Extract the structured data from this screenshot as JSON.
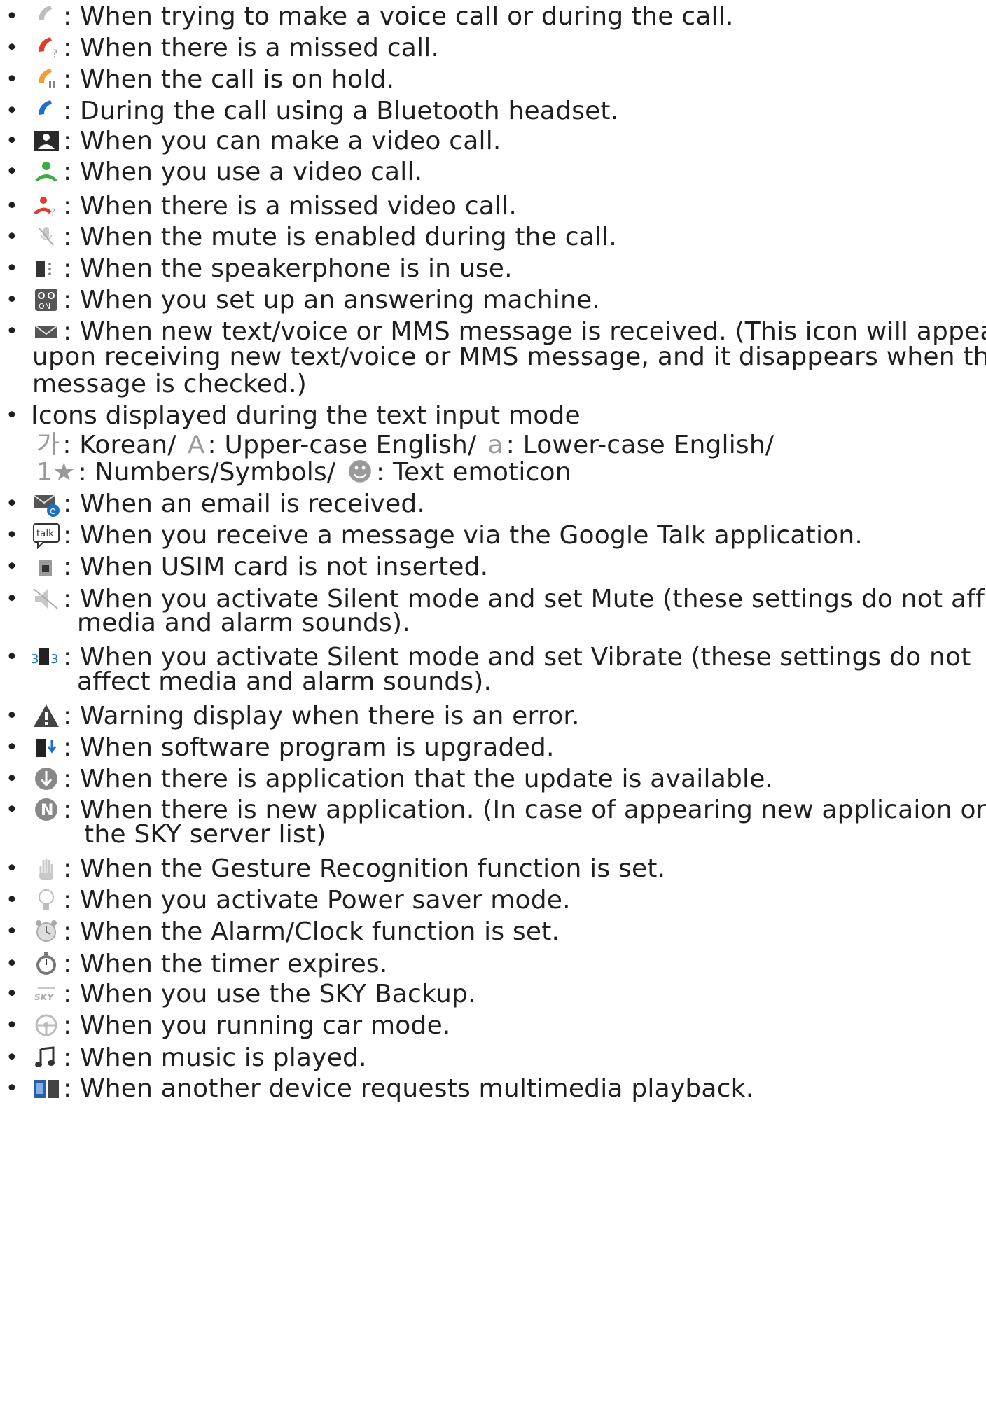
{
  "items": [
    {
      "icon": "phone-gray-icon",
      "text": ": When trying to make a voice call or during the call."
    },
    {
      "icon": "phone-missed-icon",
      "text": ": When there is a missed call."
    },
    {
      "icon": "phone-hold-icon",
      "text": ": When the call is on hold."
    },
    {
      "icon": "phone-bluetooth-icon",
      "text": ": During the call using a Bluetooth headset."
    },
    {
      "icon": "video-call-available-icon",
      "text": ": When you can make a video call."
    },
    {
      "icon": "video-call-active-icon",
      "text": ": When you use a video call."
    },
    {
      "icon": "video-call-missed-icon",
      "text": ": When there is a missed video call."
    },
    {
      "icon": "mic-mute-icon",
      "text": ": When the mute is enabled during the call."
    },
    {
      "icon": "speakerphone-icon",
      "text": ": When the speakerphone is in use."
    },
    {
      "icon": "answering-machine-icon",
      "text": ": When you set up an answering machine."
    },
    {
      "icon": "message-envelope-icon",
      "text": ": When new text/voice or MMS message is received. (This icon will appear",
      "cont": [
        "upon receiving new text/voice or MMS message, and it disappears when the",
        "message is checked.)"
      ]
    },
    {
      "icon": "",
      "text": "Icons displayed during the text input mode"
    },
    {
      "icon": "email-received-icon",
      "text": ": When an email is received."
    },
    {
      "icon": "google-talk-icon",
      "text": ": When you receive a message via the Google Talk application."
    },
    {
      "icon": "usim-missing-icon",
      "text": ": When USIM card is not inserted."
    },
    {
      "icon": "silent-mute-icon",
      "text": ": When you activate Silent mode and set Mute (these settings do not affect",
      "cont": [
        "media and alarm sounds)."
      ]
    },
    {
      "icon": "silent-vibrate-icon",
      "text": ": When you activate Silent mode and set Vibrate (these settings do not",
      "cont": [
        "affect media and alarm sounds)."
      ]
    },
    {
      "icon": "warning-icon",
      "text": ": Warning display when there is an error."
    },
    {
      "icon": "software-upgrade-icon",
      "text": ": When software program is upgraded."
    },
    {
      "icon": "app-update-icon",
      "text": ": When there is application that the update is available."
    },
    {
      "icon": "new-app-icon",
      "text": ": When there is new application. (In case of appearing new applicaion on",
      "cont": [
        "the SKY server list)"
      ]
    },
    {
      "icon": "gesture-hand-icon",
      "text": ": When the Gesture Recognition function is set."
    },
    {
      "icon": "power-saver-bulb-icon",
      "text": ": When you activate Power saver mode."
    },
    {
      "icon": "alarm-clock-icon",
      "text": ": When the Alarm/Clock function is set."
    },
    {
      "icon": "timer-icon",
      "text": ": When the timer expires."
    },
    {
      "icon": "sky-backup-icon",
      "text": ": When you use the SKY Backup."
    },
    {
      "icon": "car-mode-icon",
      "text": ": When you running car mode."
    },
    {
      "icon": "music-note-icon",
      "text": ": When music is played."
    },
    {
      "icon": "multimedia-playback-icon",
      "text": ": When another device requests multimedia playback."
    }
  ],
  "text_input_icons": {
    "line1": [
      {
        "glyph": "가",
        "label": ": Korean/"
      },
      {
        "glyph": "A",
        "label": ": Upper-case English/"
      },
      {
        "glyph": "a",
        "label": ": Lower-case English/"
      }
    ],
    "line2": [
      {
        "glyph": "1★",
        "label": ": Numbers/Symbols/"
      },
      {
        "glyph": "☻",
        "label": ": Text emoticon"
      }
    ]
  },
  "bullet": "•",
  "icon_labels": {
    "talk": "talk",
    "sky": "SKY",
    "answering": "ON"
  }
}
